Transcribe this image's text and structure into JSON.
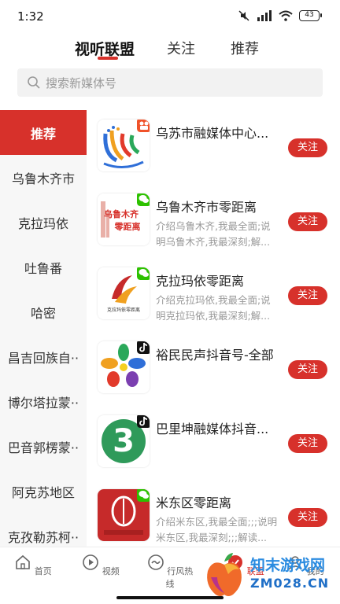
{
  "status_bar": {
    "time": "1:32",
    "battery": "43"
  },
  "top_tabs": [
    {
      "label": "视听联盟",
      "active": true
    },
    {
      "label": "关注",
      "active": false
    },
    {
      "label": "推荐",
      "active": false
    }
  ],
  "search": {
    "placeholder": "搜索新媒体号"
  },
  "sidebar": {
    "items": [
      {
        "label": "推荐",
        "active": true
      },
      {
        "label": "乌鲁木齐市"
      },
      {
        "label": "克拉玛依"
      },
      {
        "label": "吐鲁番"
      },
      {
        "label": "哈密"
      },
      {
        "label": "昌吉回族自··"
      },
      {
        "label": "博尔塔拉蒙··"
      },
      {
        "label": "巴音郭楞蒙··"
      },
      {
        "label": "阿克苏地区"
      },
      {
        "label": "克孜勒苏柯··"
      }
    ]
  },
  "cards": [
    {
      "title": "乌苏市融媒体中心...",
      "desc": "",
      "follow_label": "关注",
      "logo_icon": "wusu-logo-icon",
      "badge_icon": "video-badge-icon",
      "badge_color": "#f0532a"
    },
    {
      "title": "乌鲁木齐市零距离",
      "desc": "介绍乌鲁木齐,我最全面;说明乌鲁木齐,我最深刻;解...",
      "follow_label": "关注",
      "logo_icon": "urumqi-zero-logo-icon",
      "badge_icon": "wechat-badge-icon",
      "badge_color": "#2dc100"
    },
    {
      "title": "克拉玛依零距离",
      "desc": "介绍克拉玛依,我最全面;说明克拉玛依,我最深刻;解...",
      "follow_label": "关注",
      "logo_icon": "karamay-zero-logo-icon",
      "badge_icon": "wechat-badge-icon",
      "badge_color": "#2dc100"
    },
    {
      "title": "裕民民声抖音号-全部",
      "desc": "",
      "follow_label": "关注",
      "logo_icon": "yumin-flower-logo-icon",
      "badge_icon": "douyin-badge-icon",
      "badge_color": "#111111"
    },
    {
      "title": "巴里坤融媒体抖音...",
      "desc": "",
      "follow_label": "关注",
      "logo_icon": "barkol-logo-icon",
      "badge_icon": "douyin-badge-icon",
      "badge_color": "#111111"
    },
    {
      "title": "米东区零距离",
      "desc": "介绍米东区,我最全面;;;说明米东区,我最深刻;;;解读...",
      "follow_label": "关注",
      "logo_icon": "midong-logo-icon",
      "badge_icon": "wechat-badge-icon",
      "badge_color": "#2dc100"
    }
  ],
  "bottom_nav": [
    {
      "label": "首页",
      "icon": "home-icon"
    },
    {
      "label": "视频",
      "icon": "play-icon"
    },
    {
      "label": "行风热线",
      "icon": "hotline-icon"
    },
    {
      "label": "联盟",
      "icon": "alliance-icon",
      "active": true
    },
    {
      "label": "我的",
      "icon": "user-icon"
    }
  ],
  "watermark": {
    "text": "知末游戏网",
    "url": "ZM028.CN"
  },
  "colors": {
    "accent": "#d7312b",
    "sidebar_bg": "#f7f7f7",
    "search_bg": "#f2f2f2"
  }
}
